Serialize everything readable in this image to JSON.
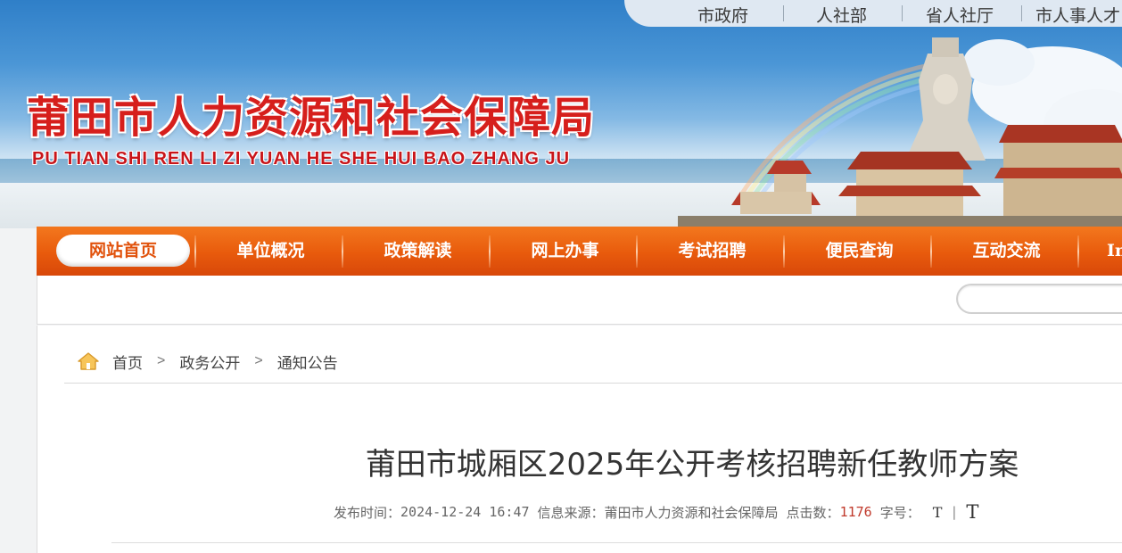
{
  "top_links": [
    "市政府",
    "人社部",
    "省人社厅",
    "市人事人才"
  ],
  "banner": {
    "name_cn": "莆田市人力资源和社会保障局",
    "name_pinyin": "PU TIAN SHI REN LI ZI YUAN HE SHE HUI BAO ZHANG JU"
  },
  "nav": {
    "active": "网站首页",
    "items": [
      "单位概况",
      "政策解读",
      "网上办事",
      "考试招聘",
      "便民查询",
      "互动交流",
      "In"
    ]
  },
  "search": {
    "value": "",
    "placeholder": ""
  },
  "breadcrumb": [
    "首页",
    "政务公开",
    "通知公告"
  ],
  "breadcrumb_separator": ">",
  "article": {
    "title": "莆田市城厢区2025年公开考核招聘新任教师方案",
    "publish_label": "发布时间：",
    "publish_time": "2024-12-24 16:47",
    "source_label": "信息来源：",
    "source": "莆田市人力资源和社会保障局",
    "clicks_label": "点击数：",
    "clicks": "1176",
    "font_label": "字号：",
    "font_small": "T",
    "font_divider": "|",
    "font_large": "T"
  },
  "icons": {
    "home": "home-icon"
  },
  "colors": {
    "nav": "#e85a0c",
    "logo": "#d61f1c",
    "count": "#c0392b"
  }
}
